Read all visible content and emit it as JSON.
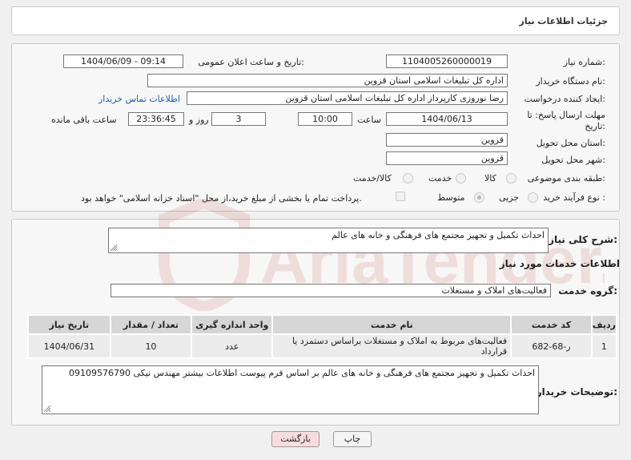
{
  "header": {
    "title": "جزئیات اطلاعات نیاز"
  },
  "form": {
    "need_number_label": "شماره نیاز:",
    "need_number": "1104005260000019",
    "announce_label": "تاریخ و ساعت اعلان عمومی:",
    "announce_value": "1404/06/09 - 09:14",
    "buyer_org_label": "نام دستگاه خریدار:",
    "buyer_org": "اداره کل تبلیغات اسلامی استان قزوین",
    "creator_label": "ایجاد کننده درخواست:",
    "creator": "رضا نوروزی کارپرداز اداره کل تبلیغات اسلامی استان قزوین",
    "contact_link": "اطلاعات تماس خریدار",
    "deadline_label_1": "مهلت ارسال پاسخ: تا",
    "deadline_label_2": "تاریخ:",
    "deadline_date": "1404/06/13",
    "time_label": "ساعت",
    "deadline_time": "10:00",
    "days_value": "3",
    "days_label": "روز و",
    "remaining_time": "23:36:45",
    "remaining_label": "ساعت باقی مانده",
    "province_label": "استان محل تحویل:",
    "province": "قزوین",
    "city_label": "شهر محل تحویل:",
    "city": "قزوین",
    "category_label": "طبقه بندی موضوعی:",
    "category_options": {
      "goods": "کالا",
      "service": "خدمت",
      "goods_service": "کالا/خدمت"
    },
    "process_label": "نوع فرآیند خرید :",
    "process_options": {
      "partial": "جزیی",
      "medium": "متوسط"
    },
    "payment_note": "پرداخت تمام یا بخشی از مبلغ خرید،از محل \"اسناد خزانه اسلامی\" خواهد بود."
  },
  "details": {
    "summary_label": "شرح کلی نیاز:",
    "summary": "احداث تکمیل و تجهیز مجتمع های فرهنگی و خانه های عالم",
    "services_title": "اطلاعات خدمات مورد نیاز",
    "service_group_label": "گروه خدمت:",
    "service_group": "فعالیت‌های  املاک و مستغلات",
    "table": {
      "headers": [
        "ردیف",
        "کد خدمت",
        "نام خدمت",
        "واحد اندازه گیری",
        "تعداد / مقدار",
        "تاریخ نیاز"
      ],
      "rows": [
        [
          "1",
          "ر-68-682",
          "فعالیت‌های مربوط به املاک و مستغلات براساس دستمزد یا قرارداد",
          "عدد",
          "10",
          "1404/06/31"
        ]
      ]
    },
    "buyer_notes_label": "توضیحات خریدار:",
    "buyer_notes": "احداث تکمیل و تجهیز مجتمع های فرهنگی و خانه های عالم بر اساس فرم پیوست اطلاعات بیشتر مهندس نیکی 09109576790"
  },
  "buttons": {
    "print": "چاپ",
    "back": "بازگشت"
  },
  "watermark": "AriaTender.neT",
  "colors": {
    "link": "#1a5fb4",
    "back_button": "#f9dcdc",
    "print_button": "#f4f4f4",
    "watermark": "#c0392b"
  }
}
